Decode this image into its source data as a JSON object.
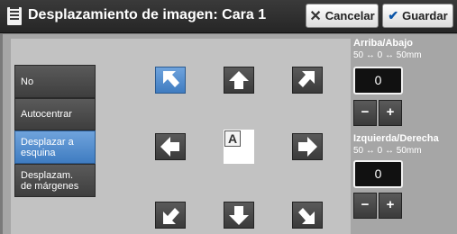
{
  "header": {
    "title": "Desplazamiento de imagen: Cara 1",
    "cancel_label": "Cancelar",
    "save_label": "Guardar"
  },
  "options": [
    {
      "label": "No",
      "selected": false
    },
    {
      "label": "Autocentrar",
      "selected": false
    },
    {
      "label": "Desplazar a esquina",
      "selected": true
    },
    {
      "label": "Desplazam. de márgenes",
      "selected": false
    }
  ],
  "center_label": "A",
  "active_direction": "top-left",
  "vertical": {
    "label": "Arriba/Abajo",
    "range": "50 ↔ 0 ↔ 50mm",
    "value": "0",
    "minus": "−",
    "plus": "+"
  },
  "horizontal": {
    "label": "Izquierda/Derecha",
    "range": "50 ↔ 0 ↔ 50mm",
    "value": "0",
    "minus": "−",
    "plus": "+"
  },
  "colors": {
    "selected": "#4a86c8",
    "title_bg": "#2e2e2e",
    "panel_bg": "#c2c2c2"
  }
}
